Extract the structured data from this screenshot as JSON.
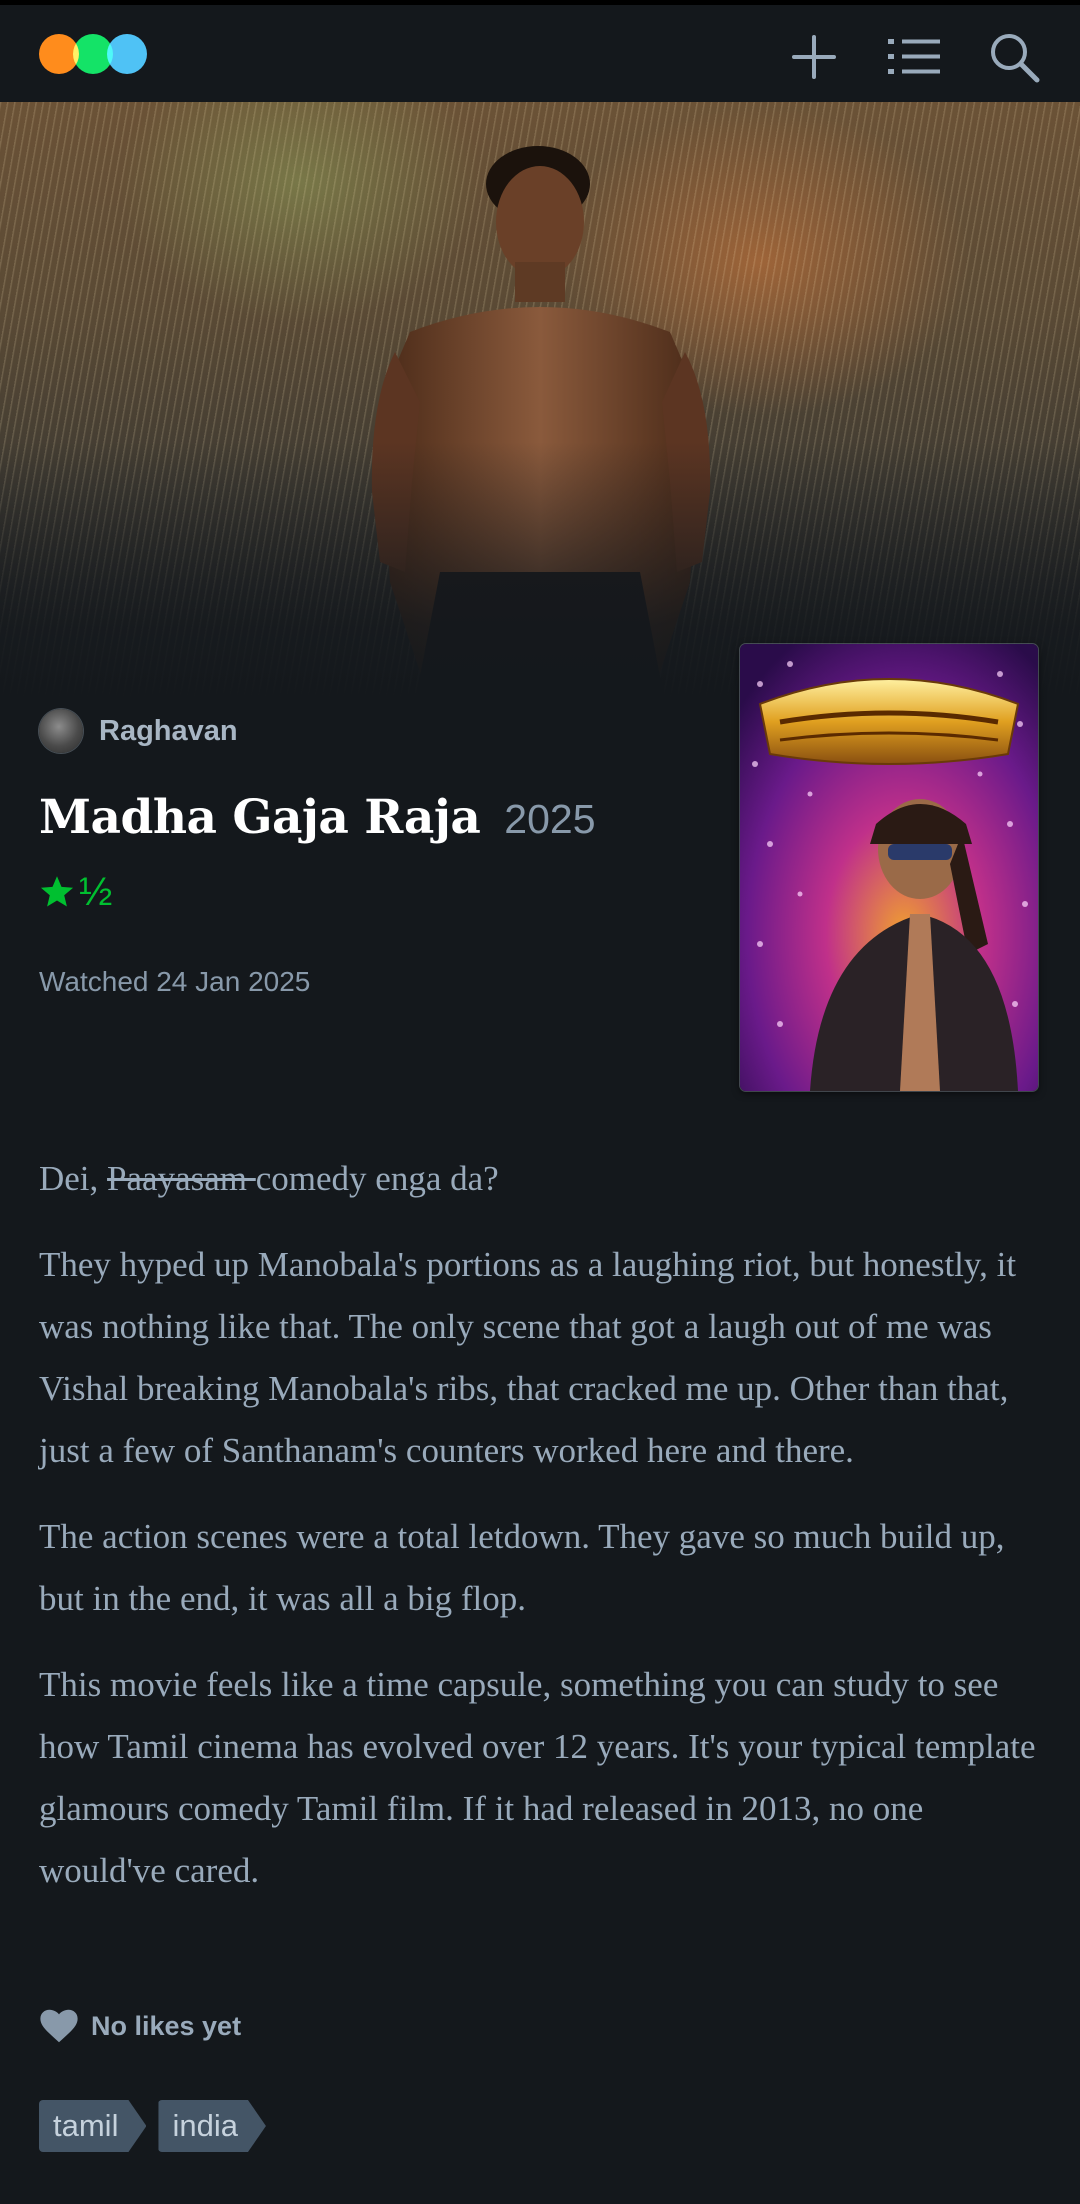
{
  "header": {
    "icons": [
      "letterboxd-logo",
      "add-icon",
      "list-icon",
      "search-icon"
    ]
  },
  "review": {
    "author": "Raghavan",
    "film_title": "Madha Gaja Raja",
    "film_year": "2025",
    "rating_half": "½",
    "rating_stars": 1.5,
    "watched": "Watched 24 Jan 2025",
    "line1_pre": "Dei, ",
    "line1_struck": "Paayasam ",
    "line1_post": "comedy enga da?",
    "paragraphs": [
      "They hyped up Manobala's portions as a laughing riot, but honestly, it was nothing like that. The only scene that got a laugh out of me was Vishal breaking Manobala's ribs, that cracked me up. Other than that, just a few of Santhanam's counters worked here and there.",
      "The action scenes were a total letdown. They gave so much build up, but in the end, it was all a big flop.",
      "This movie feels like a time capsule, something you can study to see how Tamil cinema has evolved over 12 years. It's your typical template glamours comedy Tamil film. If it had released in 2013, no one would've cared."
    ]
  },
  "likes": {
    "label": "No likes yet"
  },
  "tags": [
    "tamil",
    "india"
  ],
  "colors": {
    "background": "#14181c",
    "rating_green": "#00c030",
    "text_muted": "#99aabb",
    "tag_bg": "#445566"
  }
}
